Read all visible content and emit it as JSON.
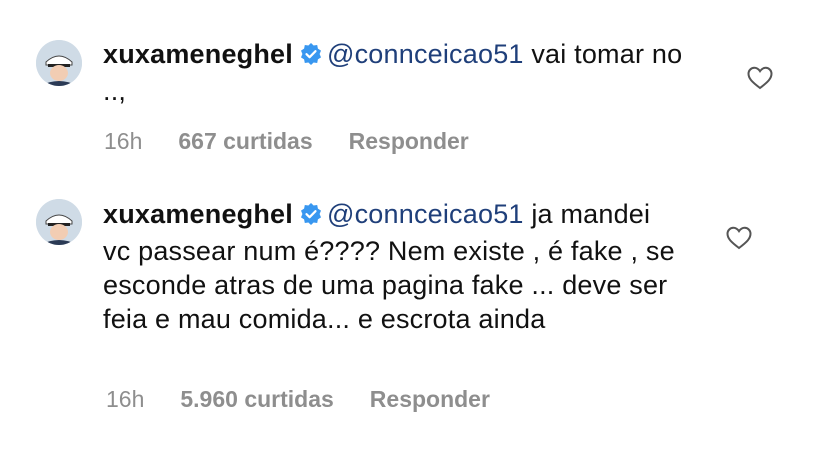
{
  "comments": [
    {
      "username": "xuxameneghel",
      "mention": "@connceicao51",
      "text": " vai tomar no ..,",
      "time": "16h",
      "likes": "667 curtidas",
      "reply_label": "Responder",
      "icons": {
        "verified": "verified-badge-icon",
        "like": "heart-icon"
      }
    },
    {
      "username": "xuxameneghel",
      "mention": "@connceicao51",
      "text": " ja mandei vc passear num é???? Nem existe , é fake , se esconde atras de uma pagina fake ... deve ser feia e mau comida... e escrota ainda",
      "time": "16h",
      "likes": "5.960 curtidas",
      "reply_label": "Responder",
      "icons": {
        "verified": "verified-badge-icon",
        "like": "heart-icon"
      }
    }
  ],
  "colors": {
    "mention": "#1f3f7a",
    "verified": "#3897f0",
    "meta": "#8e8e8e"
  }
}
